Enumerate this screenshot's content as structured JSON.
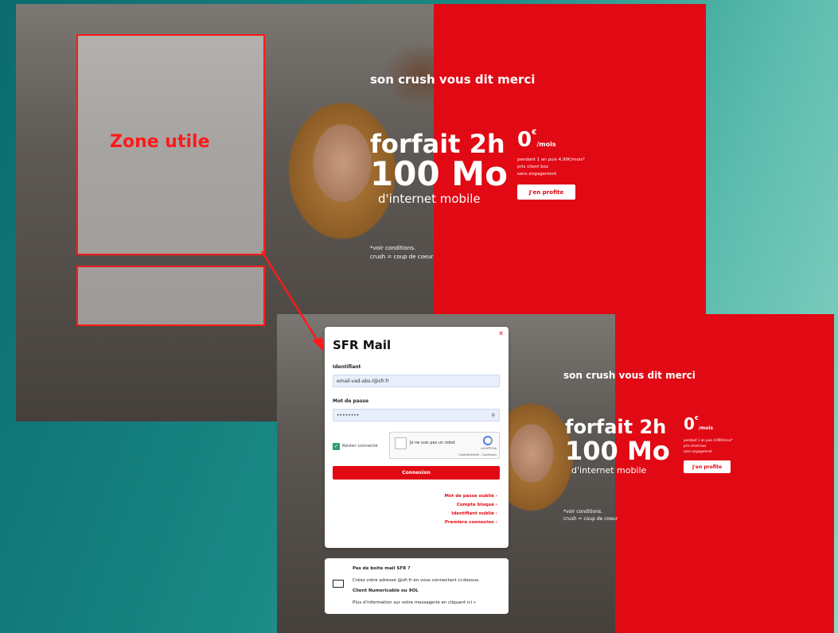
{
  "annotation": {
    "label": "Zone utile"
  },
  "promo": {
    "headline": "son crush vous dit merci",
    "offer_line1": "forfait 2h",
    "offer_line2": "100 Mo",
    "offer_line3": "d'internet mobile",
    "price": "0",
    "price_currency": "€",
    "price_unit": "/mois",
    "price_detail": [
      "pendant 1 an puis 4,99€/mois*",
      "prix client box",
      "sans engagement"
    ],
    "cta_label": "J'en profite",
    "disclaimer": [
      "*voir conditions.",
      "crush = coup de coeur"
    ]
  },
  "login": {
    "title": "SFR Mail",
    "id_label": "Identifiant",
    "id_value": "email-vad-abs-l@sfr.fr",
    "password_label": "Mot de passe",
    "password_value": "••••••••",
    "remember_label": "Rester connecté",
    "captcha_label": "Je ne suis pas un robot",
    "captcha_brand": "reCAPTCHA",
    "captcha_footer": "Confidentialité - Conditions",
    "connect_label": "Connexion",
    "links": [
      "Mot de passe oublié",
      "Compte bloqué",
      "Identifiant oublié",
      "Première connexion"
    ]
  },
  "info": {
    "title": "Pas de boite mail SFR ?",
    "line1": "Créez votre adresse @sfr.fr en vous connectant ci-dessus.",
    "title2": "Client Numericable ou 9OL",
    "line2": "Plus d'information sur votre messagerie en cliquant ici »"
  }
}
